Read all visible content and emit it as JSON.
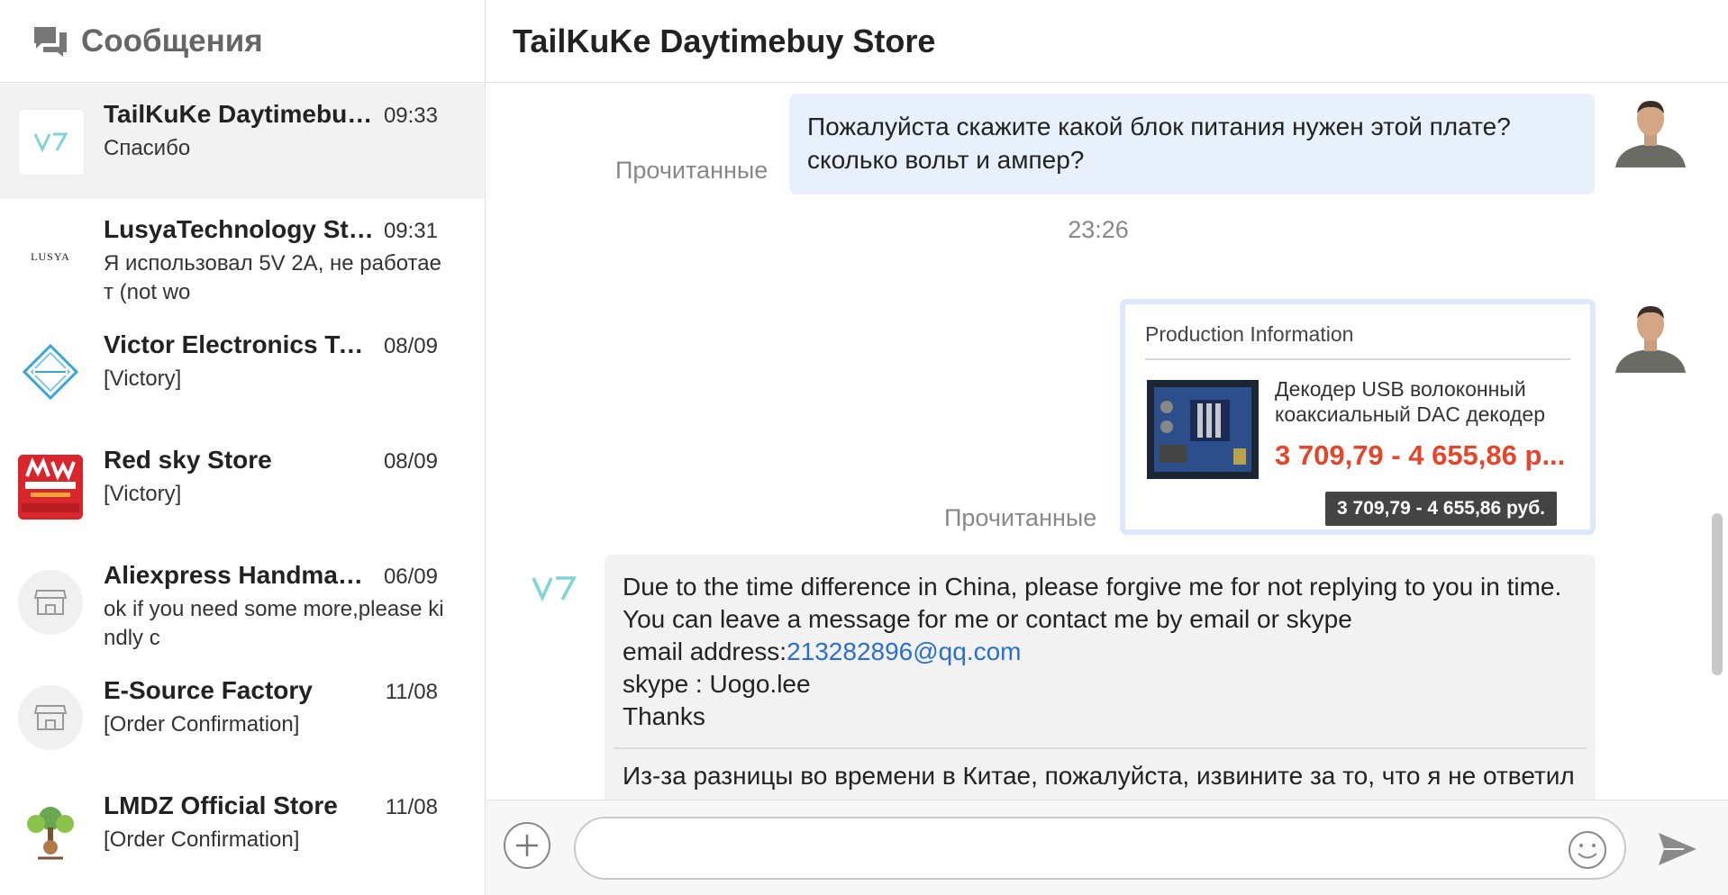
{
  "sidebar": {
    "title": "Сообщения",
    "conversations": [
      {
        "name": "TailKuKe Daytimebuy ...",
        "time": "09:33",
        "preview": "Спасибо",
        "avatar": "v7-logo"
      },
      {
        "name": "LusyaTechnology Store",
        "time": "09:31",
        "preview": "Я использовал 5V 2A, не работает (not wo",
        "avatar": "lusya-logo",
        "avatar_text": "LUSYA"
      },
      {
        "name": "Victor Electronics Too...",
        "time": "08/09",
        "preview": "[Victory]",
        "avatar": "vosoron-logo"
      },
      {
        "name": "Red sky Store",
        "time": "08/09",
        "preview": "[Victory]",
        "avatar": "meanwell-logo"
      },
      {
        "name": "Aliexpress Handmade...",
        "time": "06/09",
        "preview": "ok if you need some more,please kindly c",
        "avatar": "store-icon"
      },
      {
        "name": "E-Source Factory",
        "time": "11/08",
        "preview": "[Order Confirmation]",
        "avatar": "store-icon"
      },
      {
        "name": "LMDZ Official Store",
        "time": "11/08",
        "preview": "[Order Confirmation]",
        "avatar": "lmdz-logo"
      }
    ]
  },
  "chat": {
    "title": "TailKuKe Daytimebuy Store",
    "outgoing_1": {
      "lines": [
        "Пожалуйста скажите какой блок питания нужен этой плате?",
        "сколько вольт и ампер?"
      ],
      "status": "Прочитанные"
    },
    "time_separator": "23:26",
    "product_card": {
      "title": "Production Information",
      "description": "Декодер USB волоконный коаксиальный DAC декодер п...",
      "price": "3 709,79 - 4 655,86 р...",
      "tooltip": "3 709,79 - 4 655,86 руб.",
      "status": "Прочитанные"
    },
    "incoming_1": {
      "line1": "Due to the time difference in China, please forgive me for not replying to you in time.",
      "line2": "You can leave a message for me or  contact me by email or skype",
      "email_label": "email address:",
      "email": "213282896@qq.com",
      "line4": "skype : Uogo.lee",
      "line5": "Thanks",
      "translation": "Из-за разницы во времени в Китае, пожалуйста, извините за то, что я не ответил вам вовремя"
    }
  },
  "input": {
    "placeholder": ""
  },
  "colors": {
    "accent_blue": "#2a6fcf",
    "price_red": "#e3462a",
    "outgoing_bubble": "#e8f1fb",
    "incoming_bubble": "#f2f2f2",
    "active_conversation": "#f2f2f2"
  }
}
